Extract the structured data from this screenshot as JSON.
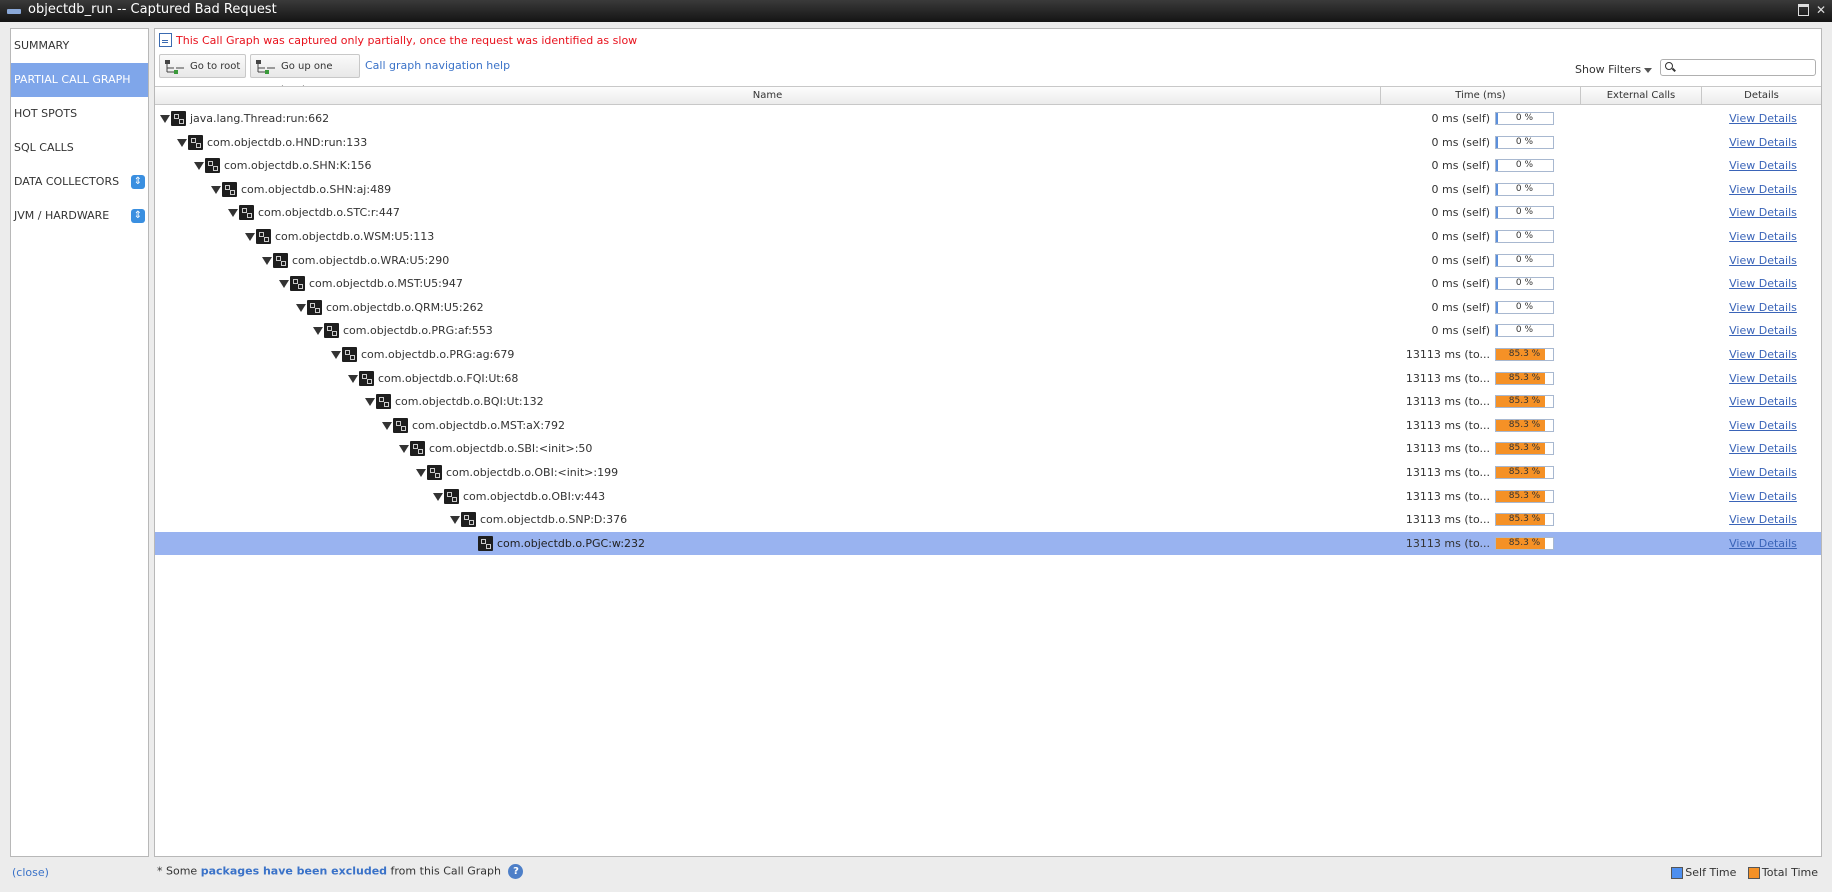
{
  "window": {
    "title": "objectdb_run -- Captured Bad Request"
  },
  "sidebar": {
    "items": [
      {
        "label": "SUMMARY",
        "active": false,
        "badge": false
      },
      {
        "label": "PARTIAL CALL GRAPH",
        "active": true,
        "badge": false
      },
      {
        "label": "HOT SPOTS",
        "active": false,
        "badge": false
      },
      {
        "label": "SQL CALLS",
        "active": false,
        "badge": false
      },
      {
        "label": "DATA COLLECTORS",
        "active": false,
        "badge": true
      },
      {
        "label": "JVM / HARDWARE",
        "active": false,
        "badge": true
      }
    ]
  },
  "main": {
    "warning": "This Call Graph was captured only partially, once the request was identified as slow",
    "toolbar": {
      "go_root_label": "Go to root",
      "go_up_label": "Go up one level",
      "help_link": "Call graph navigation help"
    },
    "filters": {
      "label": "Show Filters",
      "search_value": ""
    },
    "table": {
      "headers": {
        "name": "Name",
        "time": "Time (ms)",
        "external": "External Calls",
        "details": "Details"
      },
      "rows": [
        {
          "depth": 0,
          "name": "java.lang.Thread:run:662",
          "time": "0 ms (self)",
          "percent_label": "0 %",
          "percent": 0,
          "link": "View Details",
          "expanded": true
        },
        {
          "depth": 1,
          "name": "com.objectdb.o.HND:run:133",
          "time": "0 ms (self)",
          "percent_label": "0 %",
          "percent": 0,
          "link": "View Details",
          "expanded": true
        },
        {
          "depth": 2,
          "name": "com.objectdb.o.SHN:K:156",
          "time": "0 ms (self)",
          "percent_label": "0 %",
          "percent": 0,
          "link": "View Details",
          "expanded": true
        },
        {
          "depth": 3,
          "name": "com.objectdb.o.SHN:aj:489",
          "time": "0 ms (self)",
          "percent_label": "0 %",
          "percent": 0,
          "link": "View Details",
          "expanded": true
        },
        {
          "depth": 4,
          "name": "com.objectdb.o.STC:r:447",
          "time": "0 ms (self)",
          "percent_label": "0 %",
          "percent": 0,
          "link": "View Details",
          "expanded": true
        },
        {
          "depth": 5,
          "name": "com.objectdb.o.WSM:U5:113",
          "time": "0 ms (self)",
          "percent_label": "0 %",
          "percent": 0,
          "link": "View Details",
          "expanded": true
        },
        {
          "depth": 6,
          "name": "com.objectdb.o.WRA:U5:290",
          "time": "0 ms (self)",
          "percent_label": "0 %",
          "percent": 0,
          "link": "View Details",
          "expanded": true
        },
        {
          "depth": 7,
          "name": "com.objectdb.o.MST:U5:947",
          "time": "0 ms (self)",
          "percent_label": "0 %",
          "percent": 0,
          "link": "View Details",
          "expanded": true
        },
        {
          "depth": 8,
          "name": "com.objectdb.o.QRM:U5:262",
          "time": "0 ms (self)",
          "percent_label": "0 %",
          "percent": 0,
          "link": "View Details",
          "expanded": true
        },
        {
          "depth": 9,
          "name": "com.objectdb.o.PRG:af:553",
          "time": "0 ms (self)",
          "percent_label": "0 %",
          "percent": 0,
          "link": "View Details",
          "expanded": true
        },
        {
          "depth": 10,
          "name": "com.objectdb.o.PRG:ag:679",
          "time": "13113 ms (to...",
          "percent_label": "85.3 %",
          "percent": 85.3,
          "link": "View Details",
          "expanded": true
        },
        {
          "depth": 11,
          "name": "com.objectdb.o.FQI:Ut:68",
          "time": "13113 ms (to...",
          "percent_label": "85.3 %",
          "percent": 85.3,
          "link": "View Details",
          "expanded": true
        },
        {
          "depth": 12,
          "name": "com.objectdb.o.BQI:Ut:132",
          "time": "13113 ms (to...",
          "percent_label": "85.3 %",
          "percent": 85.3,
          "link": "View Details",
          "expanded": true
        },
        {
          "depth": 13,
          "name": "com.objectdb.o.MST:aX:792",
          "time": "13113 ms (to...",
          "percent_label": "85.3 %",
          "percent": 85.3,
          "link": "View Details",
          "expanded": true
        },
        {
          "depth": 14,
          "name": "com.objectdb.o.SBI:<init>:50",
          "time": "13113 ms (to...",
          "percent_label": "85.3 %",
          "percent": 85.3,
          "link": "View Details",
          "expanded": true
        },
        {
          "depth": 15,
          "name": "com.objectdb.o.OBI:<init>:199",
          "time": "13113 ms (to...",
          "percent_label": "85.3 %",
          "percent": 85.3,
          "link": "View Details",
          "expanded": true
        },
        {
          "depth": 16,
          "name": "com.objectdb.o.OBI:v:443",
          "time": "13113 ms (to...",
          "percent_label": "85.3 %",
          "percent": 85.3,
          "link": "View Details",
          "expanded": true
        },
        {
          "depth": 17,
          "name": "com.objectdb.o.SNP:D:376",
          "time": "13113 ms (to...",
          "percent_label": "85.3 %",
          "percent": 85.3,
          "link": "View Details",
          "expanded": true
        },
        {
          "depth": 18,
          "name": "com.objectdb.o.PGC:w:232",
          "time": "13113 ms (to...",
          "percent_label": "85.3 %",
          "percent": 85.3,
          "link": "View Details",
          "expanded": false,
          "selected": true
        }
      ]
    }
  },
  "footer": {
    "close": "(close)",
    "note_prefix": "* Some",
    "note_link": "packages have been excluded",
    "note_suffix": "from this Call Graph",
    "help": "?",
    "legend_self": "Self Time",
    "legend_total": "Total Time"
  },
  "colors": {
    "accent": "#7fa6ea",
    "total_bar": "#f59126",
    "self_bar": "#4d8ff0",
    "warning": "#e8111c",
    "link": "#3a64b8"
  }
}
